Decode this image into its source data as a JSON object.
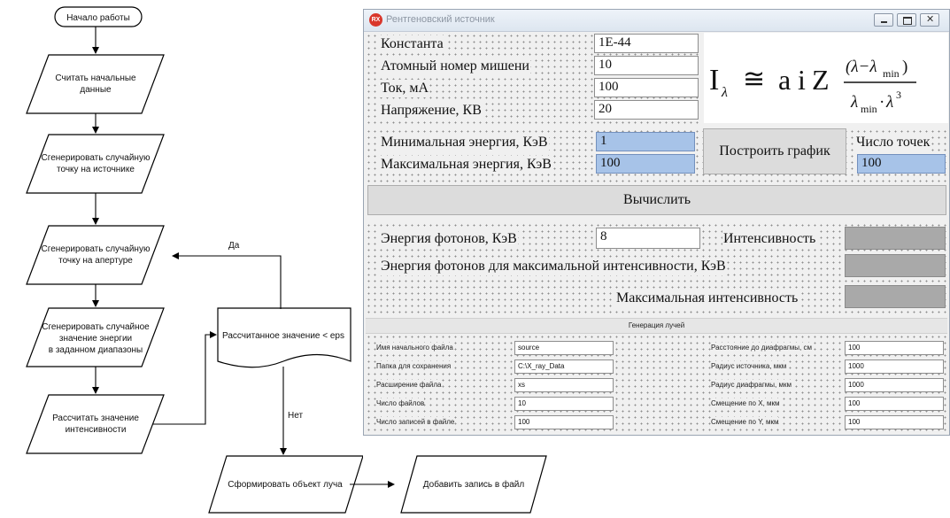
{
  "flowchart": {
    "start": "Начало работы",
    "read_data": [
      "Считать начальные",
      "данные"
    ],
    "gen_source_point": [
      "Сгенерировать случайную",
      "точку на источнике"
    ],
    "gen_aperture_point": [
      "Сгенерировать случайную",
      "точку на апертуре"
    ],
    "gen_energy": [
      "Сгенерировать случайное",
      "значение энергии",
      "в заданном диапазоны"
    ],
    "calc_intensity": [
      "Рассчитать значение",
      "интенсивности"
    ],
    "condition": "Рассчитанное значение < eps",
    "yes_label": "Да",
    "no_label": "Нет",
    "form_ray": "Сформировать объект луча",
    "add_record": "Добавить запись в файл"
  },
  "window": {
    "title": "Рентгеновский источник",
    "icon_text": "RX",
    "fields": {
      "constant": {
        "label": "Константа",
        "value": "1E-44"
      },
      "atomic_number": {
        "label": "Атомный номер мишени",
        "value": "10"
      },
      "current": {
        "label": "Ток, мА",
        "value": "100"
      },
      "voltage": {
        "label": "Напряжение, КВ",
        "value": "20"
      },
      "min_energy": {
        "label": "Минимальная энергия, КэВ",
        "value": "1"
      },
      "max_energy": {
        "label": "Максимальная энергия, КэВ",
        "value": "100"
      },
      "points": {
        "label": "Число точек",
        "value": "100"
      },
      "photon_energy": {
        "label": "Энергия фотонов, КэВ",
        "value": "8"
      },
      "intensity": {
        "label": "Интенсивность",
        "value": ""
      },
      "max_intensity_energy": {
        "label": "Энергия фотонов для максимальной интенсивности, КэВ",
        "value": ""
      },
      "max_intensity": {
        "label": "Максимальная интенсивность",
        "value": ""
      }
    },
    "buttons": {
      "plot": "Построить график",
      "compute": "Вычислить"
    },
    "ray_section": {
      "title": "Генерация лучей",
      "left": [
        {
          "label": "Имя начального файла",
          "value": "source"
        },
        {
          "label": "Папка для сохранения",
          "value": "C:\\X_ray_Data"
        },
        {
          "label": "Расширение файла",
          "value": "xs"
        },
        {
          "label": "Число файлов",
          "value": "10"
        },
        {
          "label": "Число записей в файле",
          "value": "100"
        }
      ],
      "right": [
        {
          "label": "Расстояние до диафрагмы, см",
          "value": "100"
        },
        {
          "label": "Радиус источника, мкм",
          "value": "1000"
        },
        {
          "label": "Радиус диафрагмы, мкм",
          "value": "1000"
        },
        {
          "label": "Смещение по X, мкм",
          "value": "100"
        },
        {
          "label": "Смещение по Y, мкм",
          "value": "100"
        }
      ]
    }
  }
}
